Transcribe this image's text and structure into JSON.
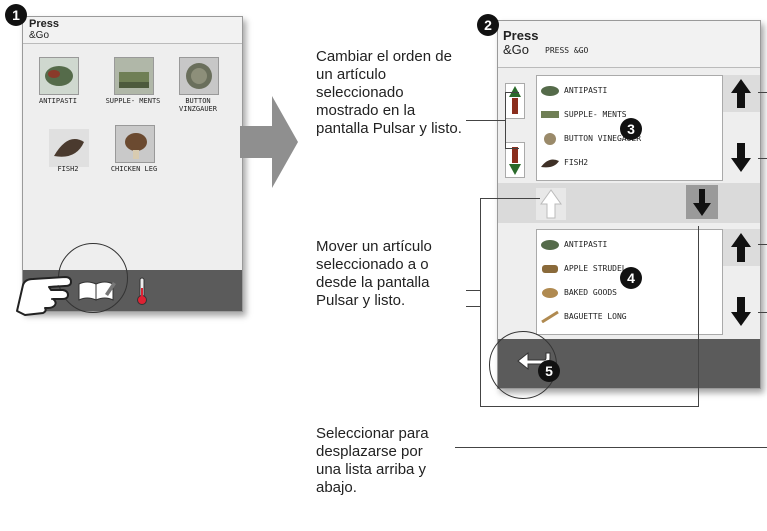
{
  "screen1": {
    "title_line1": "Press",
    "title_line2": "&Go",
    "tiles": [
      {
        "label": "ANTIPASTI"
      },
      {
        "label": "SUPPLE- MENTS"
      },
      {
        "label": "BUTTON VINZGAUER"
      },
      {
        "label": "FISH2"
      },
      {
        "label": "CHICKEN LEG"
      }
    ],
    "bottom_icons": [
      "book-edit-icon",
      "thermometer-icon"
    ]
  },
  "screen2": {
    "title_line1": "Press",
    "title_line2": "&Go",
    "header_text": "PRESS &GO",
    "top_list": [
      "ANTIPASTI",
      "SUPPLE- MENTS",
      "BUTTON VINEGAUER",
      "FISH2"
    ],
    "bottom_list": [
      "ANTIPASTI",
      "APPLE STRUDEL",
      "BAKED GOODS",
      "BAGUETTE LONG"
    ]
  },
  "badges": [
    "1",
    "2",
    "3",
    "4",
    "5"
  ],
  "descriptions": {
    "reorder": "Cambiar el orden de un artículo seleccionado mostrado en la pantalla Pulsar y listo.",
    "move": "Mover un artículo seleccionado a o desde la pantalla Pulsar y listo.",
    "scroll": "Seleccionar para desplazarse por una lista arriba y abajo."
  },
  "colors": {
    "bar": "#5b5b5b",
    "screen_bg": "#eeeeee",
    "arrow_gray": "#999999",
    "badge": "#111111"
  }
}
